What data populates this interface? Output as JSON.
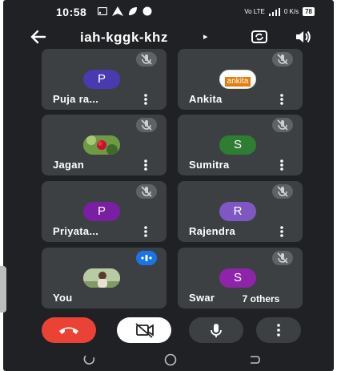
{
  "status_bar": {
    "time": "10:58",
    "network_label": "Vo LTE",
    "speed": "0 K/s",
    "battery": "78"
  },
  "header": {
    "meeting_code": "iah-kggk-khz",
    "caret": "▸"
  },
  "participants": [
    {
      "name": "Puja ra...",
      "avatar_type": "initial",
      "initial": "P",
      "avatar_color": "#4a3ab0",
      "mic": "muted"
    },
    {
      "name": "Ankita",
      "avatar_type": "image-label",
      "image_text": "ankita",
      "avatar_color": "#e67c0c",
      "mic": "muted"
    },
    {
      "name": "Jagan",
      "avatar_type": "photo",
      "photo_desc": "red-flower",
      "mic": "muted"
    },
    {
      "name": "Sumitra",
      "avatar_type": "initial",
      "initial": "S",
      "avatar_color": "#2e7d32",
      "mic": "muted"
    },
    {
      "name": "Priyata...",
      "avatar_type": "initial",
      "initial": "P",
      "avatar_color": "#7b1fa2",
      "mic": "muted"
    },
    {
      "name": "Rajendra",
      "avatar_type": "initial",
      "initial": "R",
      "avatar_color": "#7e57c2",
      "mic": "muted"
    },
    {
      "name": "You",
      "avatar_type": "photo",
      "photo_desc": "person-outdoors",
      "mic": "speaking"
    },
    {
      "name": "Swar",
      "avatar_type": "initial",
      "initial": "S",
      "avatar_color": "#8e24aa",
      "mic": "muted"
    }
  ],
  "others_label": "7 others",
  "controls": {
    "end_call_color": "#ea4335",
    "camera_off_bg": "#ffffff",
    "button_bg": "#3c4043"
  },
  "icons": {
    "back": "arrow-left-icon",
    "flip_camera": "flip-camera-icon",
    "speaker": "speaker-icon",
    "mic_off": "mic-off-icon",
    "more": "more-vert-icon",
    "end_call": "call-end-icon",
    "camera_off": "videocam-off-icon",
    "mic": "mic-icon"
  }
}
